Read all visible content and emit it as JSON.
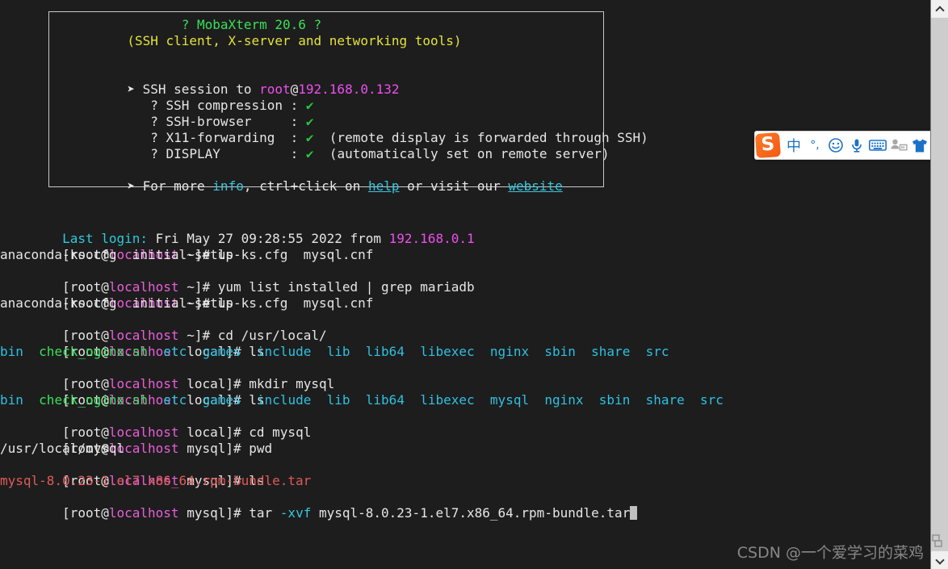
{
  "window": {
    "title": "MobaXterm 20.6 — SSH session root@192.168.0.132"
  },
  "banner": {
    "title_line": "                 ? MobaXterm 20.6 ?",
    "subtitle_line": "          (SSH client, X-server and networking tools)",
    "session_bullet": "➤ ",
    "session_label": "SSH session to ",
    "session_user": "root",
    "session_at": "@",
    "session_host": "192.168.0.132",
    "features": [
      {
        "indent": "   ? ",
        "name": "SSH compression",
        "pad": " ",
        "sep": ": ",
        "mark": "✔",
        "note": ""
      },
      {
        "indent": "   ? ",
        "name": "SSH-browser",
        "pad": "     ",
        "sep": ": ",
        "mark": "✔",
        "note": ""
      },
      {
        "indent": "   ? ",
        "name": "X11-forwarding",
        "pad": "  ",
        "sep": ": ",
        "mark": "✔",
        "note": "  (remote display is forwarded through SSH)"
      },
      {
        "indent": "   ? ",
        "name": "DISPLAY",
        "pad": "         ",
        "sep": ": ",
        "mark": "✔",
        "note": "  (automatically set on remote server)"
      }
    ],
    "footer_bullet": "➤ ",
    "footer_a": "For more ",
    "footer_info": "info",
    "footer_b": ", ctrl+click on ",
    "footer_help": "help",
    "footer_c": " or visit our ",
    "footer_website": "website"
  },
  "terminal": {
    "last_login": {
      "label": "Last login: ",
      "when": "Fri May 27 09:28:55 2022 from ",
      "from_ip": "192.168.0.1"
    },
    "prompt_open": "[root@",
    "prompt_host": "localhost",
    "prompts": [
      {
        "cwd": " ~]# ",
        "cmd": "ls"
      },
      {
        "cwd": " ~]# ",
        "cmd": "yum list installed | grep mariadb"
      },
      {
        "cwd": " ~]# ",
        "cmd": "ls"
      },
      {
        "cwd": " ~]# ",
        "cmd": "cd /usr/local/"
      },
      {
        "cwd": " local]# ",
        "cmd": "ls"
      },
      {
        "cwd": " local]# ",
        "cmd": "mkdir mysql"
      },
      {
        "cwd": " local]# ",
        "cmd": "ls"
      },
      {
        "cwd": " local]# ",
        "cmd": "cd mysql"
      },
      {
        "cwd": " mysql]# ",
        "cmd": "pwd"
      },
      {
        "cwd": " mysql]# ",
        "cmd": "ls"
      },
      {
        "cwd": " mysql]# ",
        "cmd_pre": "tar ",
        "cmd_flag": "-xvf",
        "cmd_post": " mysql-8.0.23-1.el7.x86_64.rpm-bundle.tar"
      }
    ],
    "home_ls_output": "anaconda-ks.cfg  initial-setup-ks.cfg  mysql.cnf",
    "local_ls_1": [
      {
        "name": "bin",
        "kind": "dir"
      },
      {
        "name": "check_nginx.sh",
        "kind": "exec"
      },
      {
        "name": "etc",
        "kind": "dir"
      },
      {
        "name": "games",
        "kind": "dir"
      },
      {
        "name": "include",
        "kind": "dir"
      },
      {
        "name": "lib",
        "kind": "dir"
      },
      {
        "name": "lib64",
        "kind": "dir"
      },
      {
        "name": "libexec",
        "kind": "dir"
      },
      {
        "name": "nginx",
        "kind": "dir"
      },
      {
        "name": "sbin",
        "kind": "dir"
      },
      {
        "name": "share",
        "kind": "dir"
      },
      {
        "name": "src",
        "kind": "dir"
      }
    ],
    "local_ls_2": [
      {
        "name": "bin",
        "kind": "dir"
      },
      {
        "name": "check_nginx.sh",
        "kind": "exec"
      },
      {
        "name": "etc",
        "kind": "dir"
      },
      {
        "name": "games",
        "kind": "dir"
      },
      {
        "name": "include",
        "kind": "dir"
      },
      {
        "name": "lib",
        "kind": "dir"
      },
      {
        "name": "lib64",
        "kind": "dir"
      },
      {
        "name": "libexec",
        "kind": "dir"
      },
      {
        "name": "mysql",
        "kind": "dir"
      },
      {
        "name": "nginx",
        "kind": "dir"
      },
      {
        "name": "sbin",
        "kind": "dir"
      },
      {
        "name": "share",
        "kind": "dir"
      },
      {
        "name": "src",
        "kind": "dir"
      }
    ],
    "pwd_output": "/usr/local/mysql",
    "tarball": "mysql-8.0.23-1.el7.x86_64.rpm-bundle.tar"
  },
  "ime": {
    "logo_text": "S",
    "items": [
      {
        "icon": "chinese-mode-icon",
        "glyph": "中",
        "dim": false,
        "small": false
      },
      {
        "icon": "punctuation-mode-icon",
        "glyph": "°,",
        "dim": false,
        "small": true
      },
      {
        "icon": "emoji-icon",
        "glyph": "☺",
        "dim": false,
        "small": false
      },
      {
        "icon": "microphone-icon",
        "glyph": "🎙",
        "dim": false,
        "small": false
      },
      {
        "icon": "keyboard-icon",
        "glyph": "⌨",
        "dim": false,
        "small": false
      },
      {
        "icon": "user-card-icon",
        "glyph": "☰",
        "dim": true,
        "small": true
      },
      {
        "icon": "skin-shirt-icon",
        "glyph": "⬟",
        "dim": false,
        "small": false
      }
    ]
  },
  "scrollbar": {
    "up_label": "scroll up",
    "down_label": "scroll down"
  },
  "watermark": {
    "text": "CSDN @一个爱学习的菜鸡"
  },
  "colors": {
    "background": "#1d1d1d",
    "foreground": "#e6e6e6",
    "green": "#3ae05a",
    "yellow": "#e3e33b",
    "cyan": "#36c8e0",
    "magenta": "#ee4fee",
    "red": "#e05a5a",
    "accent_orange": "#f25a12",
    "accent_blue": "#1a72c8"
  }
}
